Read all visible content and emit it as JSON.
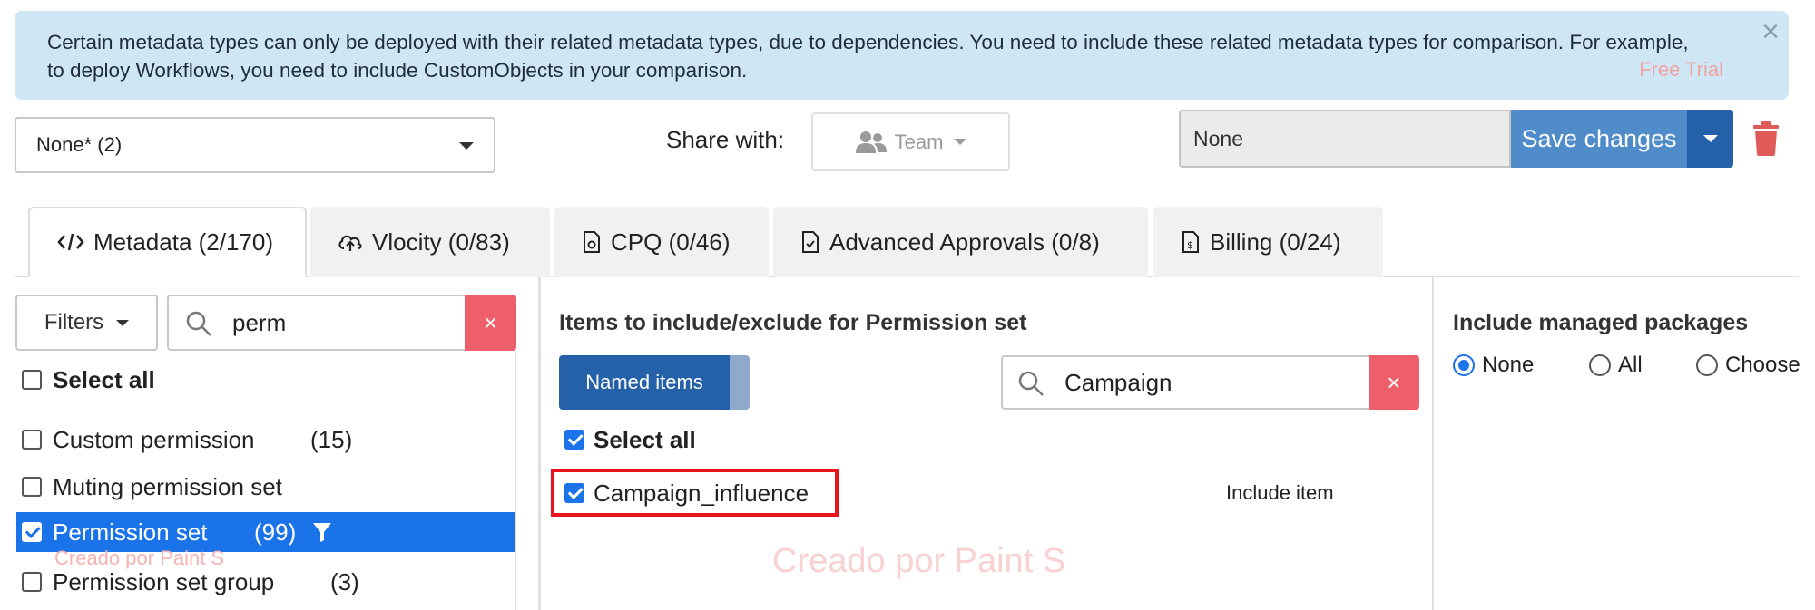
{
  "alert": {
    "message": "Certain metadata types can only be deployed with their related metadata types, due to dependencies. You need to include these related metadata types for comparison. For example, to deploy Workflows, you need to include CustomObjects in your comparison.",
    "close_glyph": "×",
    "overlay_text": "Free Trial"
  },
  "toolbar": {
    "comparison_value": "None* (2)",
    "share_label": "Share with:",
    "share_value": "Team",
    "name_value": "None",
    "save_label": "Save changes"
  },
  "tabs": [
    {
      "label": "Metadata (2/170)",
      "icon": "code-icon",
      "active": true
    },
    {
      "label": "Vlocity (0/83)",
      "icon": "cloud-upload-icon",
      "active": false
    },
    {
      "label": "CPQ (0/46)",
      "icon": "document-gear-icon",
      "active": false
    },
    {
      "label": "Advanced Approvals (0/8)",
      "icon": "document-check-icon",
      "active": false
    },
    {
      "label": "Billing (0/24)",
      "icon": "document-dollar-icon",
      "active": false
    }
  ],
  "left": {
    "filters_label": "Filters",
    "search_value": "perm",
    "clear_glyph": "×",
    "select_all": "Select all",
    "items": [
      {
        "label": "Custom permission",
        "count": "(15)",
        "checked": false,
        "selected": false
      },
      {
        "label": "Muting permission set",
        "count": "",
        "checked": false,
        "selected": false
      },
      {
        "label": "Permission set",
        "count": "(99)",
        "checked": true,
        "selected": true
      },
      {
        "label": "Permission set group",
        "count": "(3)",
        "checked": false,
        "selected": false
      }
    ]
  },
  "middle": {
    "title": "Items to include/exclude for Permission set",
    "named_items_label": "Named items",
    "search_value": "Campaign",
    "clear_glyph": "×",
    "select_all": "Select all",
    "item_label": "Campaign_influence",
    "include_label": "Include item",
    "watermark": "Creado por Paint S"
  },
  "right": {
    "title": "Include managed packages",
    "options": [
      {
        "label": "None",
        "selected": true
      },
      {
        "label": "All",
        "selected": false
      },
      {
        "label": "Choose",
        "selected": false
      }
    ]
  },
  "colors": {
    "primary": "#2461a8",
    "save": "#4f8cc9",
    "danger": "#ee5f6b",
    "selection": "#1a73e8",
    "highlight": "#e8141e",
    "alert_bg": "#cfe7f5"
  }
}
